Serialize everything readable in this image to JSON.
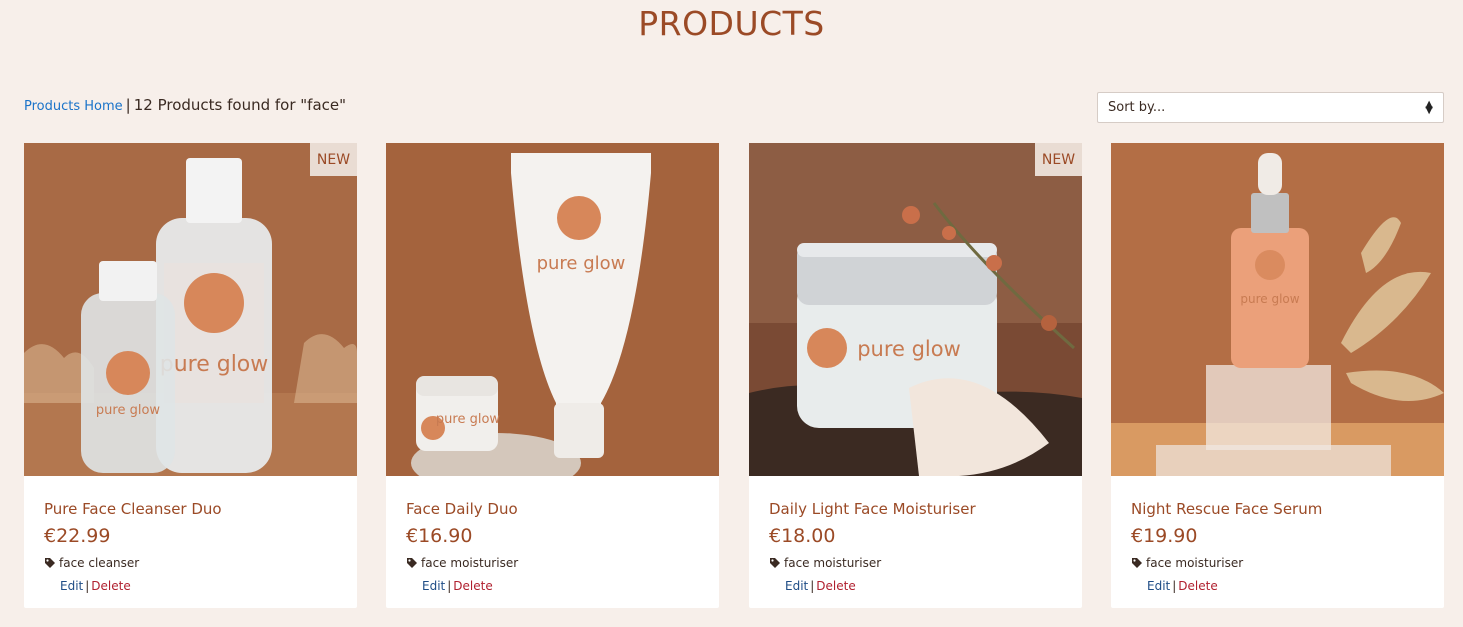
{
  "page": {
    "title": "PRODUCTS"
  },
  "breadcrumb": {
    "home_label": "Products Home",
    "separator": "|",
    "result_text": "12 Products found for \"face\""
  },
  "sort": {
    "selected": "Sort by..."
  },
  "actions": {
    "edit": "Edit",
    "delete": "Delete",
    "separator": "|"
  },
  "products": [
    {
      "name": "Pure Face Cleanser Duo",
      "price": "€22.99",
      "tag": "face cleanser",
      "badge": "NEW"
    },
    {
      "name": "Face Daily Duo",
      "price": "€16.90",
      "tag": "face moisturiser",
      "badge": ""
    },
    {
      "name": "Daily Light Face Moisturiser",
      "price": "€18.00",
      "tag": "face moisturiser",
      "badge": "NEW"
    },
    {
      "name": "Night Rescue Face Serum",
      "price": "€19.90",
      "tag": "face moisturiser",
      "badge": ""
    }
  ],
  "image_labels": {
    "brand": "pure glow"
  },
  "colors": {
    "accent": "#9b4a26",
    "link": "#1a73c9",
    "delete": "#b01f2e",
    "background": "#f7efea"
  },
  "icons": {
    "tag": "tag-icon",
    "sort": "sort-arrows-icon"
  }
}
